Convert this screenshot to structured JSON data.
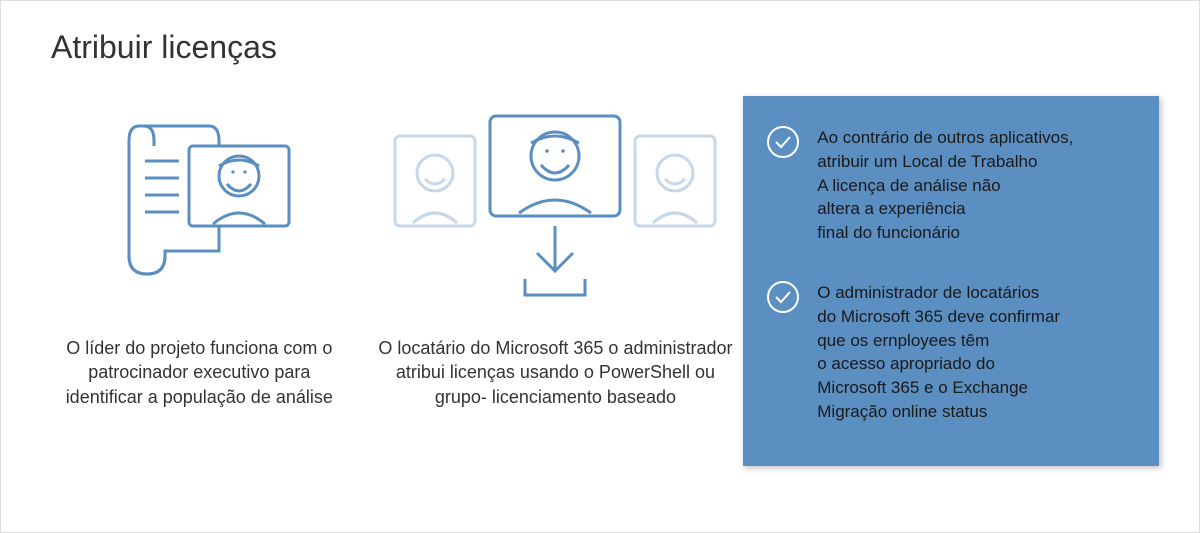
{
  "title": "Atribuir licenças",
  "col1": {
    "caption": "O líder do projeto funciona com\no patrocinador executivo para\nidentificar a população de análise"
  },
  "col2": {
    "caption": "O locatário do Microsoft 365\no administrador atribui\nlicenças usando o PowerShell ou grupo-\nlicenciamento baseado"
  },
  "side": {
    "item1": "Ao contrário de outros aplicativos,\natribuir um Local de Trabalho\nA licença de análise não\naltera a experiência\nfinal do funcionário",
    "item2": "O administrador de locatários\ndo Microsoft 365 deve confirmar\nque os ernployees têm\no acesso apropriado do\nMicrosoft 365 e o Exchange\nMigração online status"
  }
}
